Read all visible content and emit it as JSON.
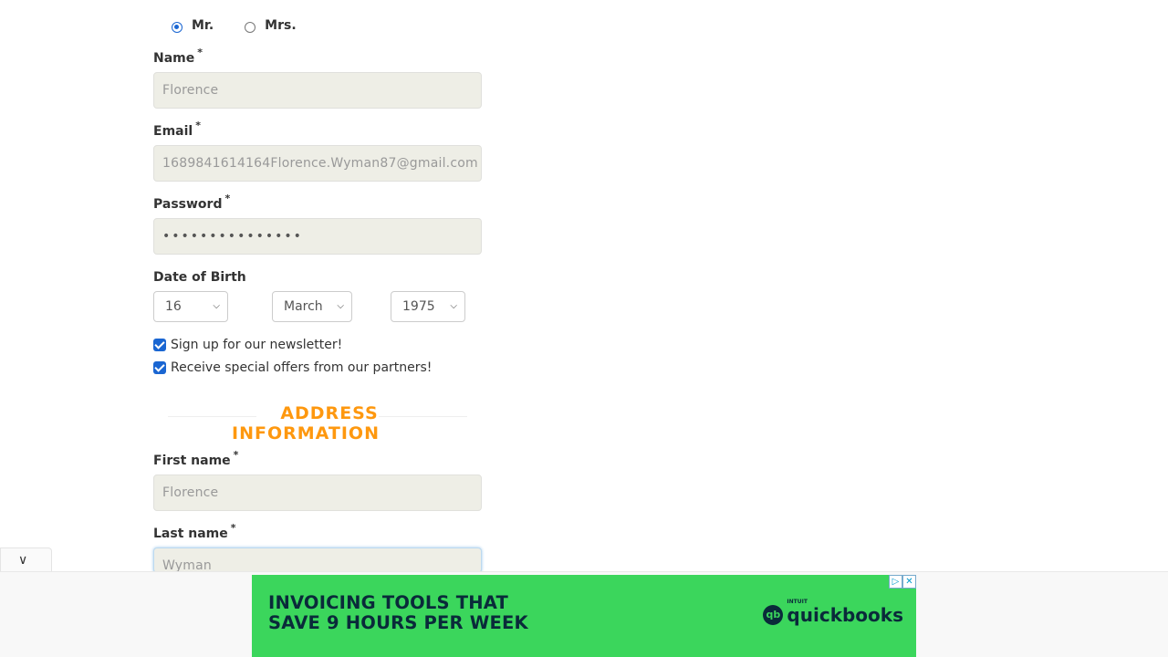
{
  "title_radio": {
    "options": [
      {
        "label": "Mr.",
        "checked": true
      },
      {
        "label": "Mrs.",
        "checked": false
      }
    ]
  },
  "account": {
    "name_label": "Name",
    "name_value": "Florence",
    "email_label": "Email",
    "email_value": "1689841614164Florence.Wyman87@gmail.com",
    "password_label": "Password",
    "password_value": "•••••••••••••••",
    "required_mark": "*",
    "dob_label": "Date of Birth",
    "dob_day": "16",
    "dob_month": "March",
    "dob_year": "1975",
    "newsletter_label": "Sign up for our newsletter!",
    "offers_label": "Receive special offers from our partners!"
  },
  "address": {
    "section_title": "ADDRESS INFORMATION",
    "first_name_label": "First name",
    "first_name_value": "Florence",
    "last_name_label": "Last name",
    "last_name_value": "Wyman"
  },
  "ad": {
    "headline_line1": "INVOICING TOOLS THAT",
    "headline_line2": "SAVE 9 HOURS PER WEEK",
    "brand_small": "INTUIT",
    "brand": "quickbooks",
    "brand_logo": "qb",
    "adchoices_icon": "▷",
    "close_icon": "✕",
    "background_color": "#3bd65c"
  },
  "icons": {
    "collapse": "chevron-down-icon",
    "select": "chevron-down-icon"
  },
  "colors": {
    "accent": "#fe980f",
    "checkbox": "#1a66d2",
    "field_bg": "#eeeee6"
  }
}
